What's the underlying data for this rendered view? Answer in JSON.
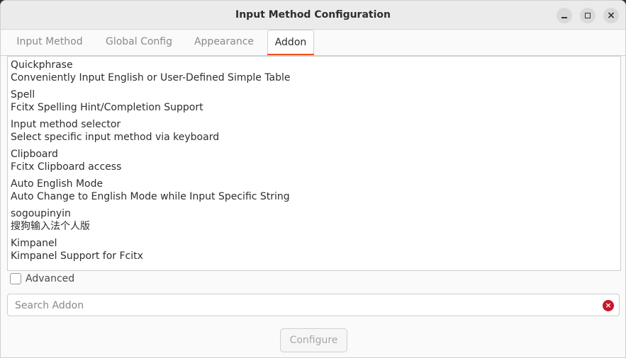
{
  "window": {
    "title": "Input Method Configuration",
    "controls": {
      "minimize": "minimize-icon",
      "maximize": "maximize-icon",
      "close": "close-icon"
    }
  },
  "tabs": [
    {
      "label": "Input Method",
      "active": false
    },
    {
      "label": "Global Config",
      "active": false
    },
    {
      "label": "Appearance",
      "active": false
    },
    {
      "label": "Addon",
      "active": true
    }
  ],
  "addons": [
    {
      "name": "Quickphrase",
      "description": "Conveniently Input English or User-Defined Simple Table"
    },
    {
      "name": "Spell",
      "description": "Fcitx Spelling Hint/Completion Support"
    },
    {
      "name": "Input method selector",
      "description": "Select specific input method via keyboard"
    },
    {
      "name": "Clipboard",
      "description": "Fcitx Clipboard access"
    },
    {
      "name": "Auto English Mode",
      "description": "Auto Change to English Mode while Input Specific String"
    },
    {
      "name": "sogoupinyin",
      "description": "搜狗输入法个人版"
    },
    {
      "name": "Kimpanel",
      "description": "Kimpanel Support for Fcitx"
    }
  ],
  "advanced": {
    "label": "Advanced",
    "checked": false
  },
  "search": {
    "placeholder": "Search Addon",
    "value": ""
  },
  "configure": {
    "label": "Configure",
    "enabled": false
  },
  "colors": {
    "accent": "#e95420",
    "clear_icon": "#c7162b"
  }
}
